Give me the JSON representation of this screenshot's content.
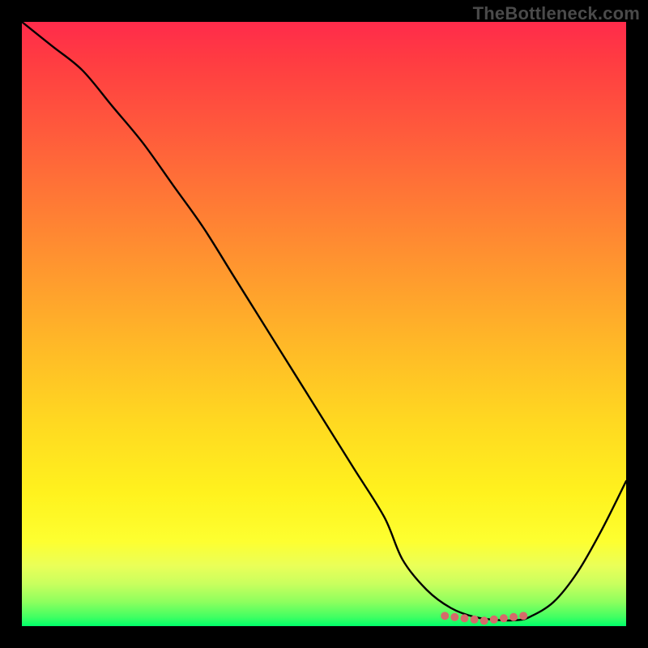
{
  "watermark": "TheBottleneck.com",
  "colors": {
    "frame": "#000000",
    "curve": "#000000",
    "dots": "#d66a6a",
    "gradient_top": "#ff2b4b",
    "gradient_bottom": "#00ff6a"
  },
  "chart_data": {
    "type": "line",
    "title": "",
    "xlabel": "",
    "ylabel": "",
    "ylim": [
      0,
      100
    ],
    "xlim": [
      0,
      100
    ],
    "x": [
      0,
      5,
      10,
      15,
      20,
      25,
      30,
      35,
      40,
      45,
      50,
      55,
      60,
      63,
      67,
      71,
      75,
      79,
      82,
      84,
      88,
      92,
      96,
      100
    ],
    "values": [
      100,
      96,
      92,
      86,
      80,
      73,
      66,
      58,
      50,
      42,
      34,
      26,
      18,
      11,
      6,
      3,
      1.5,
      1,
      1,
      1.5,
      4,
      9,
      16,
      24
    ],
    "flat_zone": {
      "x_start": 70,
      "x_end": 83,
      "y": 1.2,
      "dot_count": 9
    }
  }
}
